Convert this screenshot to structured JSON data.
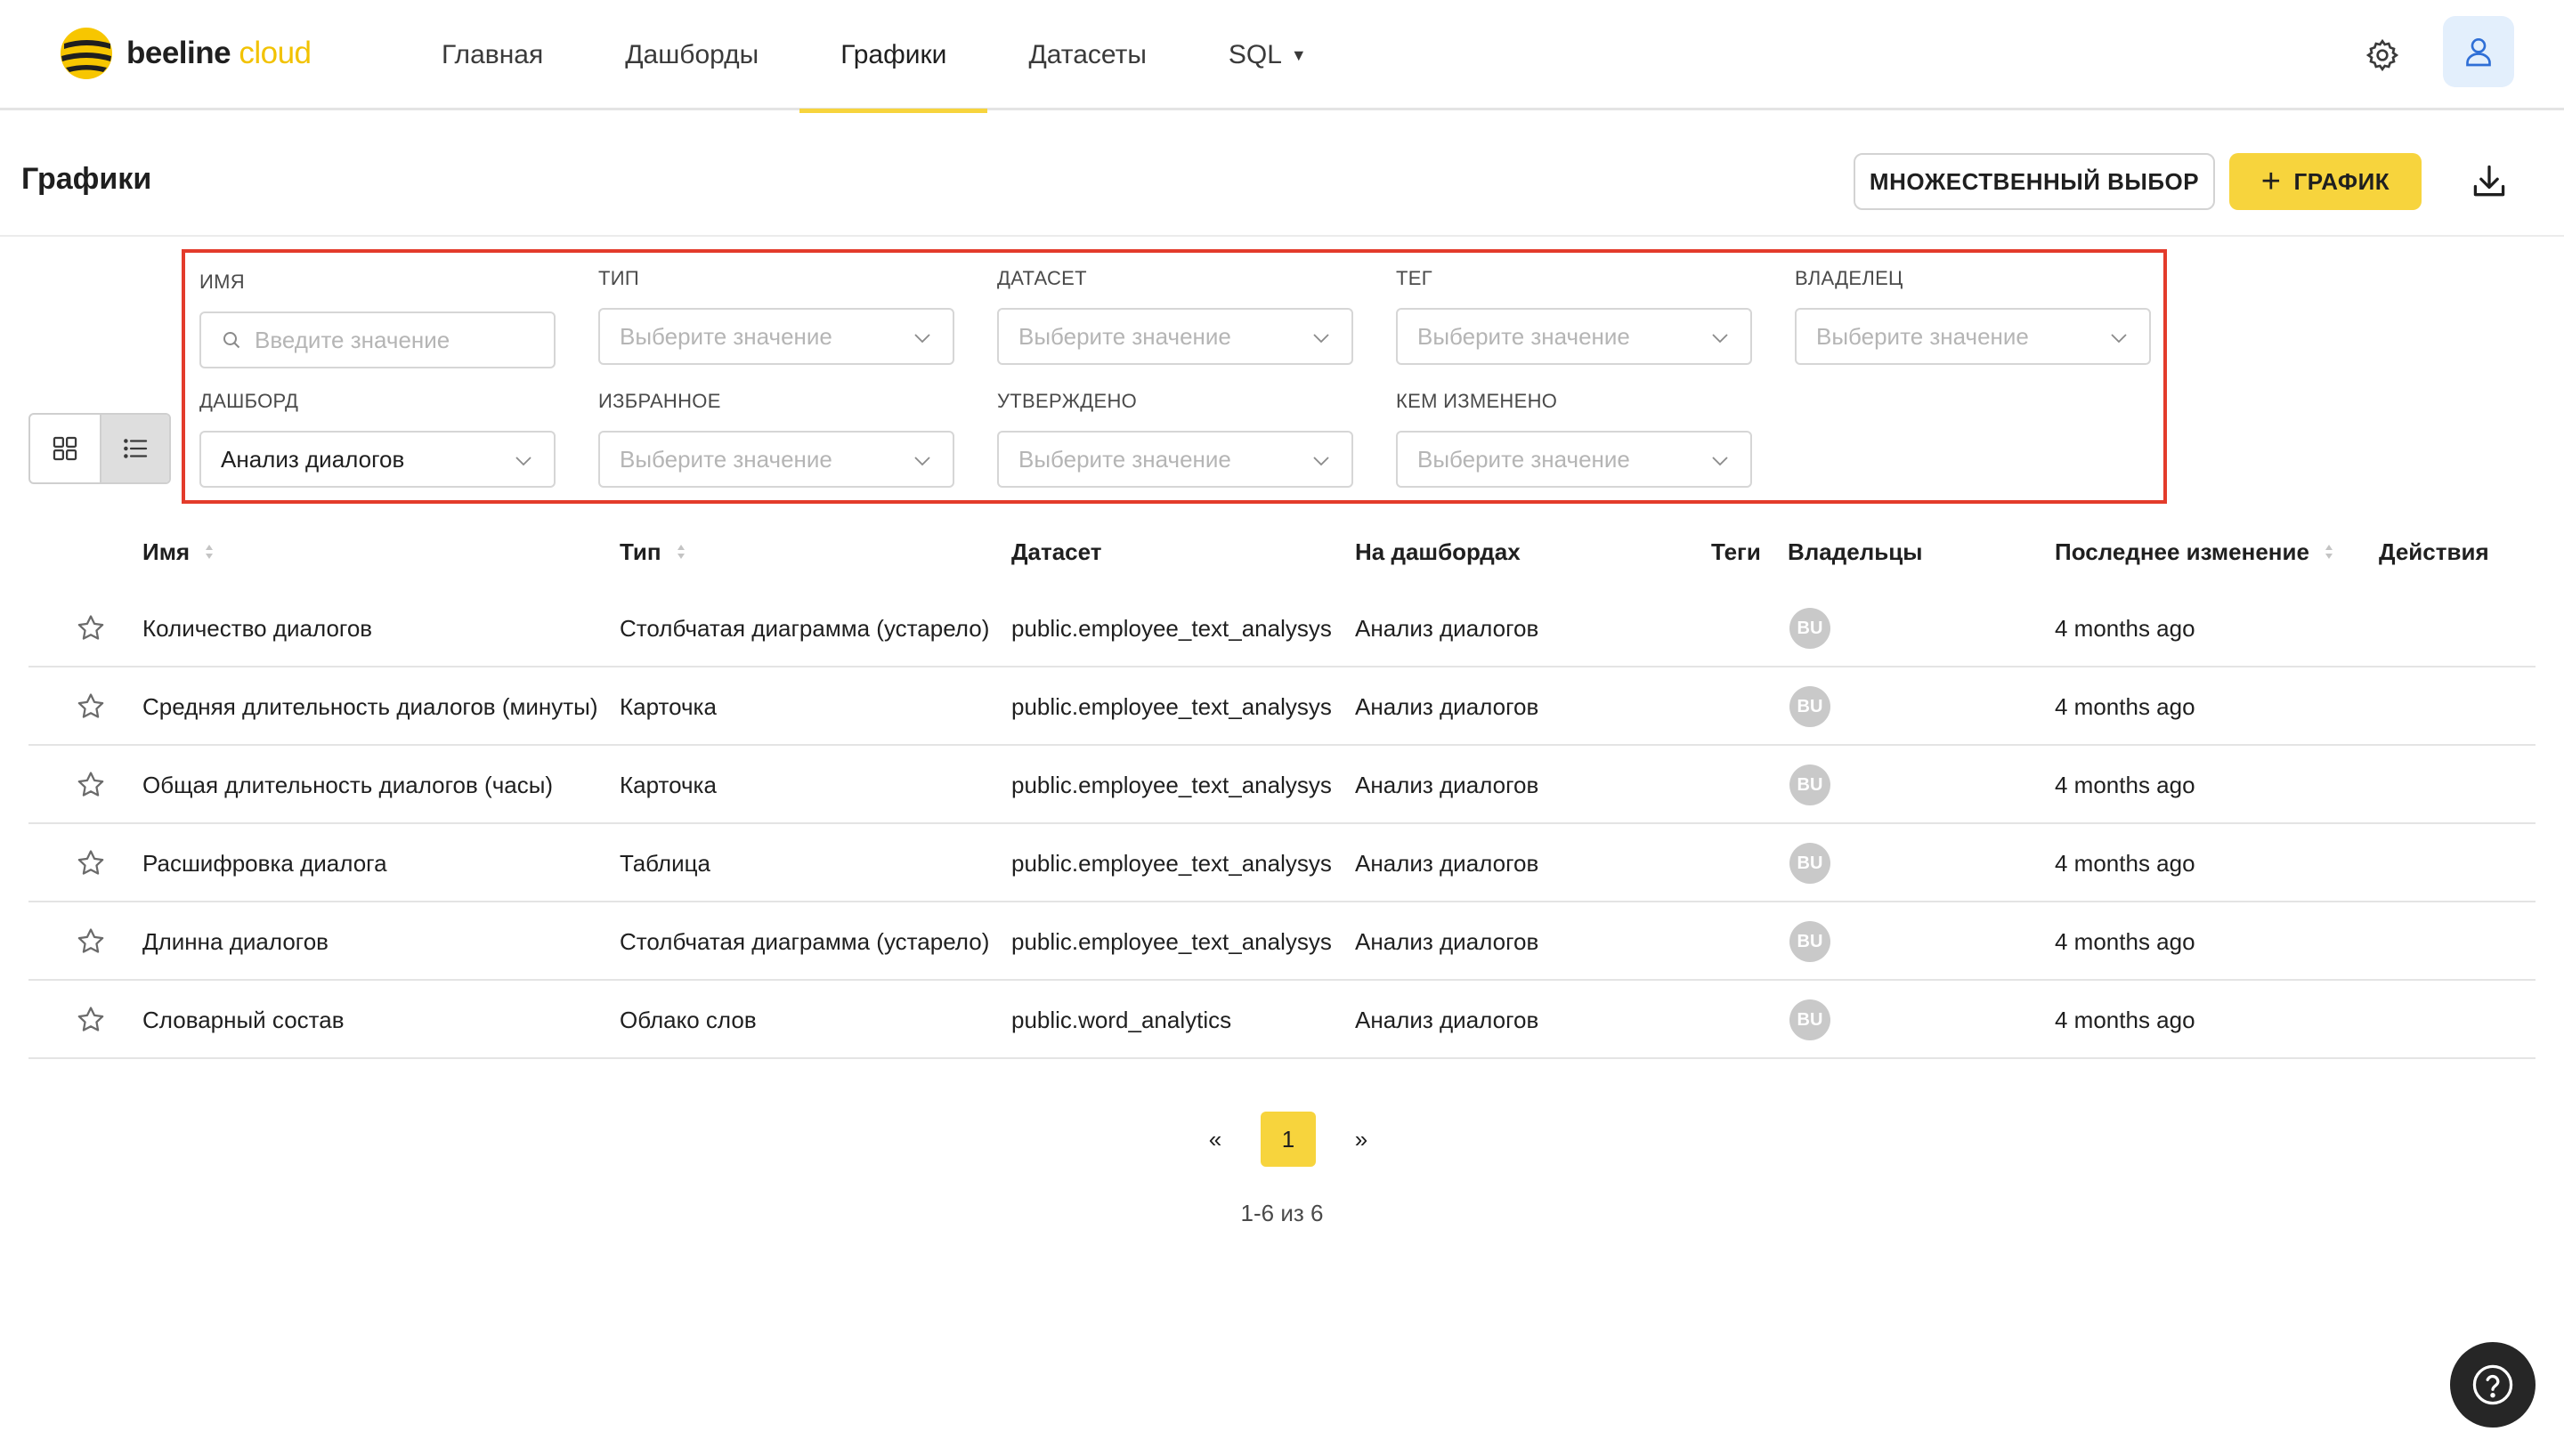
{
  "app": {
    "logo_main": "beeline",
    "logo_accent": "cloud"
  },
  "nav": {
    "items": [
      {
        "label": "Главная"
      },
      {
        "label": "Дашборды"
      },
      {
        "label": "Графики"
      },
      {
        "label": "Датасеты"
      },
      {
        "label": "SQL"
      }
    ],
    "active": "Графики"
  },
  "page": {
    "title": "Графики",
    "multi_select_label": "МНОЖЕСТВЕННЫЙ ВЫБОР",
    "add_chart_label": "ГРАФИК"
  },
  "filters": {
    "name": {
      "label": "ИМЯ",
      "placeholder": "Введите значение"
    },
    "type": {
      "label": "ТИП",
      "placeholder": "Выберите значение"
    },
    "dataset": {
      "label": "ДАТАСЕТ",
      "placeholder": "Выберите значение"
    },
    "tag": {
      "label": "ТЕГ",
      "placeholder": "Выберите значение"
    },
    "owner": {
      "label": "ВЛАДЕЛЕЦ",
      "placeholder": "Выберите значение"
    },
    "dashboard": {
      "label": "ДАШБОРД",
      "value": "Анализ диалогов"
    },
    "favorite": {
      "label": "ИЗБРАННОЕ",
      "placeholder": "Выберите значение"
    },
    "approved": {
      "label": "УТВЕРЖДЕНО",
      "placeholder": "Выберите значение"
    },
    "modified_by": {
      "label": "КЕМ ИЗМЕНЕНО",
      "placeholder": "Выберите значение"
    }
  },
  "table": {
    "columns": {
      "name": "Имя",
      "type": "Тип",
      "dataset": "Датасет",
      "dashboards": "На дашбордах",
      "tags": "Теги",
      "owners": "Владельцы",
      "modified": "Последнее изменение",
      "actions": "Действия"
    },
    "rows": [
      {
        "name": "Количество диалогов",
        "type": "Столбчатая диаграмма (устарело)",
        "dataset": "public.employee_text_analysys",
        "dashboard": "Анализ диалогов",
        "owner": "BU",
        "modified": "4 months ago"
      },
      {
        "name": "Средняя длительность диалогов (минуты)",
        "type": "Карточка",
        "dataset": "public.employee_text_analysys",
        "dashboard": "Анализ диалогов",
        "owner": "BU",
        "modified": "4 months ago"
      },
      {
        "name": "Общая длительность диалогов (часы)",
        "type": "Карточка",
        "dataset": "public.employee_text_analysys",
        "dashboard": "Анализ диалогов",
        "owner": "BU",
        "modified": "4 months ago"
      },
      {
        "name": "Расшифровка диалога",
        "type": "Таблица",
        "dataset": "public.employee_text_analysys",
        "dashboard": "Анализ диалогов",
        "owner": "BU",
        "modified": "4 months ago"
      },
      {
        "name": "Длинна диалогов",
        "type": "Столбчатая диаграмма (устарело)",
        "dataset": "public.employee_text_analysys",
        "dashboard": "Анализ диалогов",
        "owner": "BU",
        "modified": "4 months ago"
      },
      {
        "name": "Словарный состав",
        "type": "Облако слов",
        "dataset": "public.word_analytics",
        "dashboard": "Анализ диалогов",
        "owner": "BU",
        "modified": "4 months ago"
      }
    ]
  },
  "pagination": {
    "prev": "«",
    "current": "1",
    "next": "»",
    "summary": "1-6 из 6"
  },
  "colors": {
    "accent": "#f7d43d",
    "highlight_border": "#e33b2b",
    "user_button_bg": "#e3effc"
  }
}
